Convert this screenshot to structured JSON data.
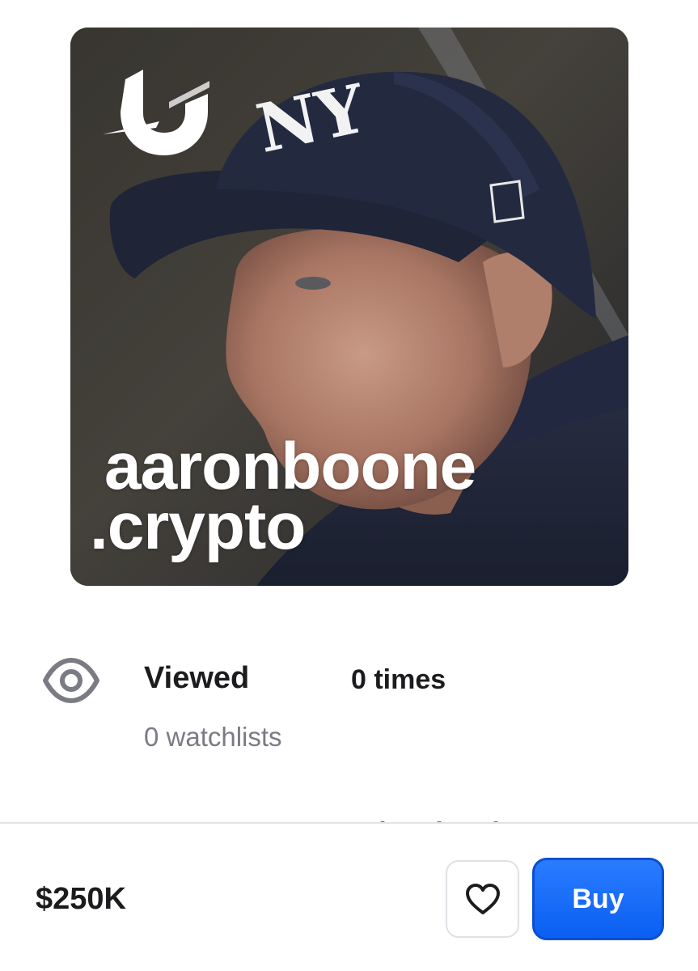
{
  "card": {
    "domain_name": "aaronboone",
    "domain_tld": ".crypto",
    "logo_icon": "unstoppable-domains-logo-icon",
    "image_subject": "baseball-manager-photo"
  },
  "stats": {
    "icon": "eye-icon",
    "viewed_label": "Viewed",
    "viewed_count": "0 times",
    "watchlists": "0 watchlists"
  },
  "action_bar": {
    "price": "$250K",
    "favorite_icon": "heart-icon",
    "buy_label": "Buy"
  },
  "colors": {
    "accent": "#0a5ff2",
    "text_primary": "#1c1c1e",
    "text_secondary": "#7b7b84",
    "card_bg": "#2e3038"
  }
}
